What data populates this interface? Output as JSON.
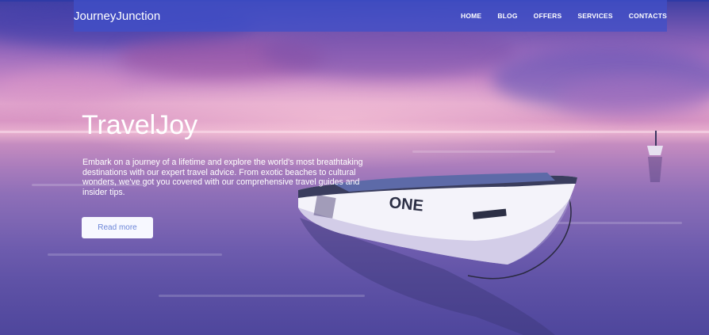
{
  "nav": {
    "brand": "JourneyJunction",
    "links": [
      "HOME",
      "BLOG",
      "OFFERS",
      "SERVICES",
      "CONTACTS"
    ]
  },
  "hero": {
    "title": "TravelJoy",
    "description": "Embark on a journey of a lifetime and explore the world's most breathtaking destinations with our expert travel advice. From exotic beaches to cultural wonders, we've got you covered with our comprehensive travel guides and insider tips.",
    "button_label": "Read more",
    "boat_text": "ONE"
  },
  "colors": {
    "navbar": "#4050c8",
    "button_text": "#6c86d8",
    "text": "#ffffff"
  }
}
